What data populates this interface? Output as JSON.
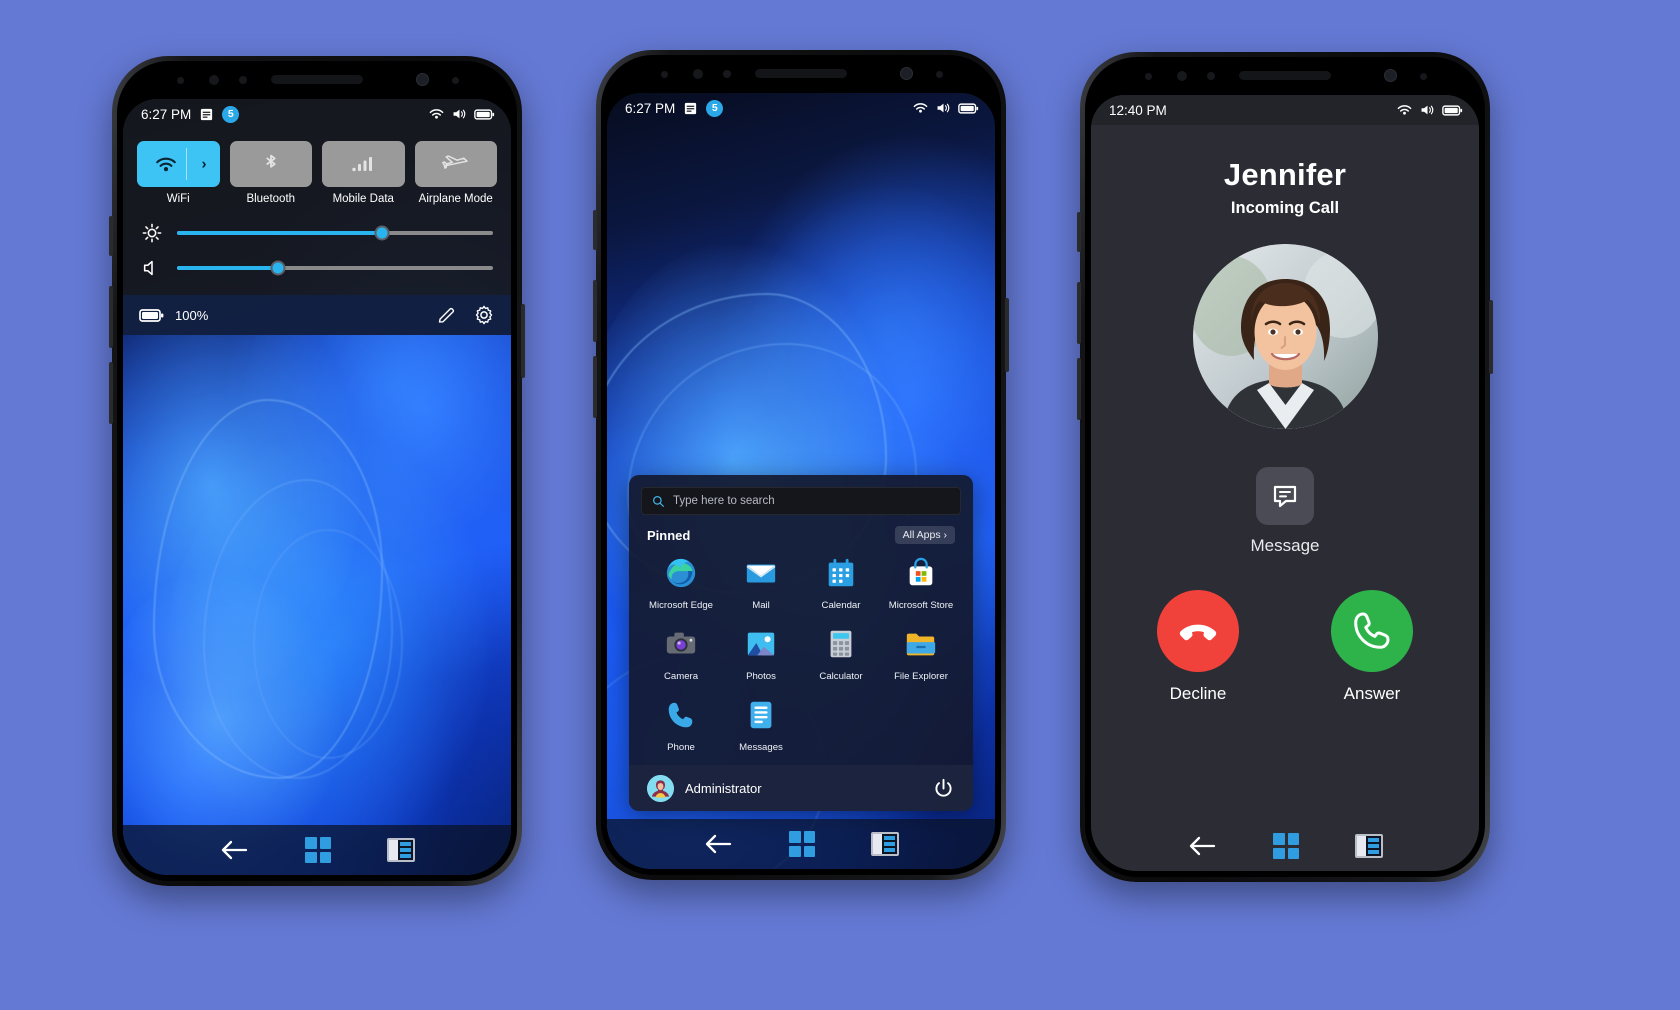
{
  "phones": {
    "quick_settings": {
      "status": {
        "time": "6:27 PM",
        "note_icon": "note-icon",
        "badge_count": "5",
        "wifi_icon": "wifi-icon",
        "volume_icon": "volume-icon",
        "battery_icon": "battery-icon"
      },
      "tiles": [
        {
          "label": "WiFi",
          "icon": "wifi-icon",
          "state": "on",
          "has_chevron": true,
          "chevron": "›"
        },
        {
          "label": "Bluetooth",
          "icon": "bluetooth-icon",
          "state": "off",
          "has_chevron": false
        },
        {
          "label": "Mobile Data",
          "icon": "signal-bars-icon",
          "state": "off",
          "has_chevron": false
        },
        {
          "label": "Airplane Mode",
          "icon": "airplane-icon",
          "state": "off",
          "has_chevron": false
        }
      ],
      "sliders": [
        {
          "name": "brightness",
          "icon": "brightness-icon",
          "value": 65
        },
        {
          "name": "volume",
          "icon": "volume-icon",
          "value": 32
        }
      ],
      "footer": {
        "battery_percent": "100%",
        "battery_icon": "battery-icon",
        "edit_icon": "pencil-icon",
        "settings_icon": "gear-icon"
      },
      "navbar": {
        "back": "back-arrow-icon",
        "home": "windows-logo-icon",
        "recents": "task-view-icon"
      }
    },
    "start_menu": {
      "status": {
        "time": "6:27 PM",
        "note_icon": "note-icon",
        "badge_count": "5",
        "wifi_icon": "wifi-icon",
        "volume_icon": "volume-icon",
        "battery_icon": "battery-icon"
      },
      "search_placeholder": "Type here to search",
      "search_value": "",
      "search_icon": "search-icon",
      "pinned_title": "Pinned",
      "all_apps_label": "All Apps ›",
      "apps": [
        {
          "name": "Microsoft Edge",
          "icon": "edge-icon"
        },
        {
          "name": "Mail",
          "icon": "mail-icon"
        },
        {
          "name": "Calendar",
          "icon": "calendar-icon"
        },
        {
          "name": "Microsoft Store",
          "icon": "store-icon"
        },
        {
          "name": "Camera",
          "icon": "camera-icon"
        },
        {
          "name": "Photos",
          "icon": "photos-icon"
        },
        {
          "name": "Calculator",
          "icon": "calculator-icon"
        },
        {
          "name": "File Explorer",
          "icon": "folder-icon"
        },
        {
          "name": "Phone",
          "icon": "phone-icon"
        },
        {
          "name": "Messages",
          "icon": "messages-icon"
        }
      ],
      "account": {
        "name": "Administrator",
        "avatar": "user-avatar",
        "power_icon": "power-icon"
      },
      "navbar": {
        "back": "back-arrow-icon",
        "home": "windows-logo-icon",
        "recents": "task-view-icon"
      }
    },
    "incoming_call": {
      "status": {
        "time": "12:40 PM",
        "wifi_icon": "wifi-icon",
        "volume_icon": "volume-icon",
        "battery_icon": "battery-icon"
      },
      "caller_name": "Jennifer",
      "call_state": "Incoming Call",
      "photo_alt": "caller-photo",
      "message_button": {
        "label": "Message",
        "icon": "message-bubble-icon"
      },
      "decline_button": {
        "label": "Decline",
        "icon": "phone-hangup-icon"
      },
      "answer_button": {
        "label": "Answer",
        "icon": "phone-icon"
      },
      "navbar": {
        "back": "back-arrow-icon",
        "home": "windows-logo-icon",
        "recents": "task-view-icon"
      }
    }
  },
  "colors": {
    "page_background": "#6479d4",
    "accent_blue": "#3ec3f5",
    "tile_off": "#9a9a9a",
    "decline_red": "#f0423a",
    "answer_green": "#2eb34a",
    "call_bg": "#2b2c34",
    "windows_blue": "#2f9de0"
  }
}
